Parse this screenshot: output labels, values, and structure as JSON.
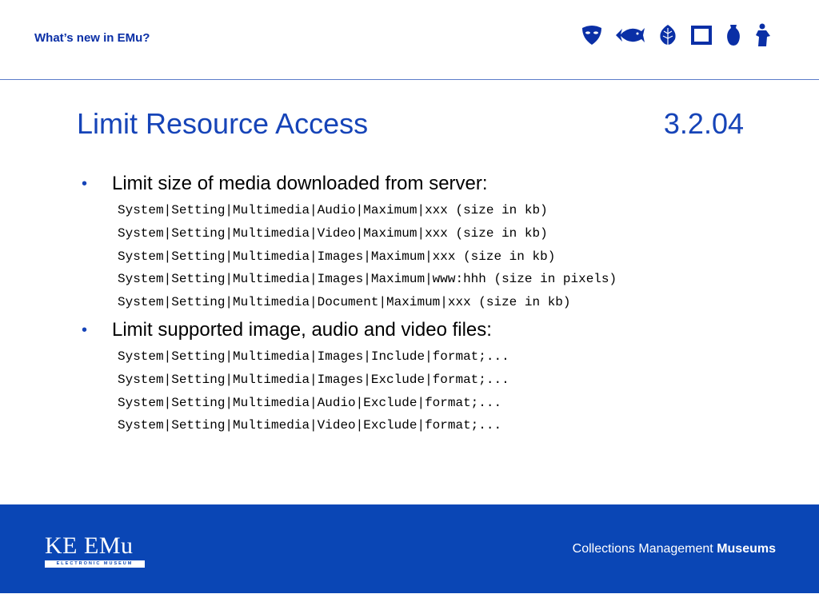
{
  "header": {
    "title": "What’s new in EMu?",
    "icons": [
      "mask-icon",
      "fish-icon",
      "leaf-icon",
      "frame-icon",
      "vase-icon",
      "statue-icon"
    ],
    "icon_color": "#0a2fa6"
  },
  "slide": {
    "title": "Limit Resource Access",
    "number": "3.2.04",
    "bullets": [
      {
        "text": "Limit size of media downloaded from server:",
        "lines": [
          "System|Setting|Multimedia|Audio|Maximum|xxx (size in kb)",
          "System|Setting|Multimedia|Video|Maximum|xxx (size in kb)",
          "System|Setting|Multimedia|Images|Maximum|xxx (size in kb)",
          "System|Setting|Multimedia|Images|Maximum|www:hhh (size in pixels)",
          "System|Setting|Multimedia|Document|Maximum|xxx (size in kb)"
        ]
      },
      {
        "text": "Limit supported image, audio and video files:",
        "lines": [
          "System|Setting|Multimedia|Images|Include|format;...",
          "System|Setting|Multimedia|Images|Exclude|format;...",
          "System|Setting|Multimedia|Audio|Exclude|format;...",
          "System|Setting|Multimedia|Video|Exclude|format;..."
        ]
      }
    ]
  },
  "footer": {
    "logo_main": "KE EMu",
    "logo_sub": "ELECTRONIC MUSEUM",
    "tagline_regular": "Collections Management",
    "tagline_bold": "Museums",
    "background": "#0a46b5"
  }
}
